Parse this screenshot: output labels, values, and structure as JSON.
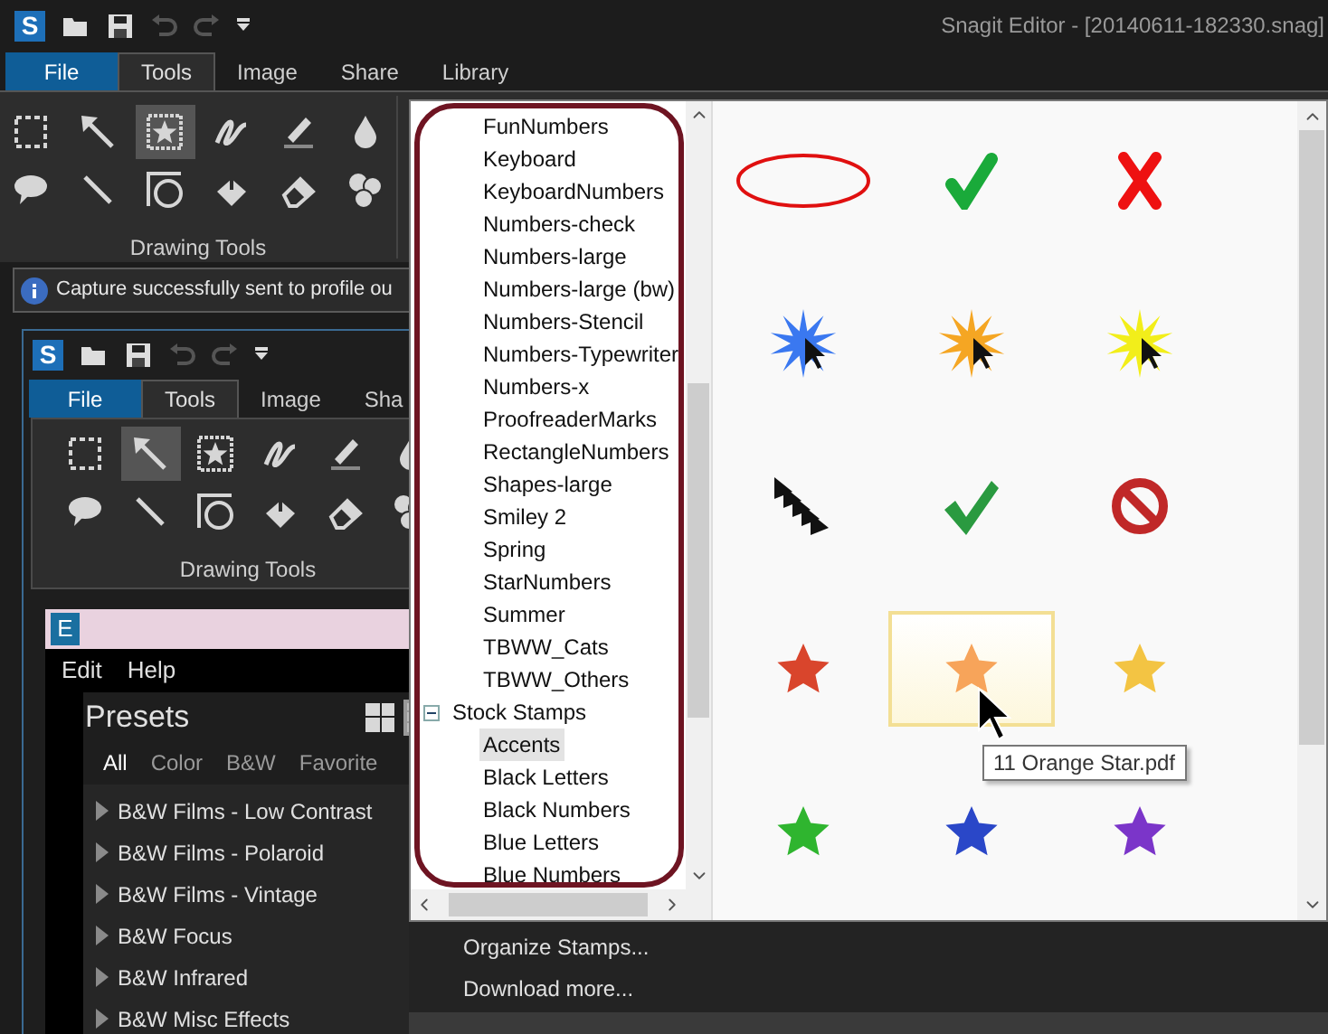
{
  "outer_window": {
    "logo": "S",
    "title": "Snagit Editor - [20140611-182330.snag]",
    "tabs": [
      {
        "label": "File",
        "kind": "file",
        "selected": false
      },
      {
        "label": "Tools",
        "kind": "tab",
        "selected": true
      },
      {
        "label": "Image",
        "kind": "tab",
        "selected": false
      },
      {
        "label": "Share",
        "kind": "tab",
        "selected": false
      },
      {
        "label": "Library",
        "kind": "tab",
        "selected": false
      }
    ],
    "tools": [
      {
        "kind": "selection",
        "selected": false
      },
      {
        "kind": "arrow",
        "selected": false
      },
      {
        "kind": "stamp",
        "selected": true
      },
      {
        "kind": "pen",
        "selected": false
      },
      {
        "kind": "highlighter",
        "selected": false
      },
      {
        "kind": "blur",
        "selected": false
      },
      {
        "kind": "callout",
        "selected": false
      },
      {
        "kind": "line",
        "selected": false
      },
      {
        "kind": "shape",
        "selected": false
      },
      {
        "kind": "fill",
        "selected": false
      },
      {
        "kind": "eraser",
        "selected": false
      },
      {
        "kind": "step",
        "selected": false
      }
    ],
    "tool_group": "Drawing Tools",
    "notification": "Capture successfully sent to profile ou"
  },
  "inner_window": {
    "logo": "S",
    "tabs": [
      {
        "label": "File",
        "kind": "file",
        "selected": false
      },
      {
        "label": "Tools",
        "kind": "tab",
        "selected": true
      },
      {
        "label": "Image",
        "kind": "tab",
        "selected": false
      },
      {
        "label": "Sha",
        "kind": "tab",
        "selected": false
      }
    ],
    "tools": [
      {
        "kind": "selection",
        "selected": false
      },
      {
        "kind": "arrow",
        "selected": true
      },
      {
        "kind": "stamp",
        "selected": false
      },
      {
        "kind": "pen",
        "selected": false
      },
      {
        "kind": "highlighter",
        "selected": false
      },
      {
        "kind": "blur",
        "selected": false
      },
      {
        "kind": "callout",
        "selected": false
      },
      {
        "kind": "line",
        "selected": false
      },
      {
        "kind": "shape",
        "selected": false
      },
      {
        "kind": "fill",
        "selected": false
      },
      {
        "kind": "eraser",
        "selected": false
      },
      {
        "kind": "step",
        "selected": false
      }
    ],
    "tool_group": "Drawing Tools"
  },
  "editor_window": {
    "logo": "E",
    "menu": [
      "Edit",
      "Help"
    ],
    "presets": {
      "title": "Presets",
      "view_modes": [
        {
          "kind": "large",
          "selected": false
        },
        {
          "kind": "small",
          "selected": true
        }
      ],
      "filters": [
        {
          "label": "All",
          "selected": true
        },
        {
          "label": "Color",
          "selected": false
        },
        {
          "label": "B&W",
          "selected": false
        },
        {
          "label": "Favorite",
          "selected": false
        }
      ],
      "items": [
        "B&W Films - Low Contrast",
        "B&W Films - Polaroid",
        "B&W Films - Vintage",
        "B&W Focus",
        "B&W Infrared",
        "B&W Misc Effects"
      ]
    }
  },
  "stamp_picker": {
    "tree": [
      {
        "children": [
          {
            "label": "FunNumbers",
            "selected": false
          },
          {
            "label": "Keyboard",
            "selected": false
          },
          {
            "label": "KeyboardNumbers",
            "selected": false
          },
          {
            "label": "Numbers-check",
            "selected": false
          },
          {
            "label": "Numbers-large",
            "selected": false
          },
          {
            "label": "Numbers-large (bw)",
            "selected": false
          },
          {
            "label": "Numbers-Stencil",
            "selected": false
          },
          {
            "label": "Numbers-Typewriter",
            "selected": false
          },
          {
            "label": "Numbers-x",
            "selected": false
          },
          {
            "label": "ProofreaderMarks",
            "selected": false
          },
          {
            "label": "RectangleNumbers",
            "selected": false
          },
          {
            "label": "Shapes-large",
            "selected": false
          },
          {
            "label": "Smiley 2",
            "selected": false
          },
          {
            "label": "Spring",
            "selected": false
          },
          {
            "label": "StarNumbers",
            "selected": false
          },
          {
            "label": "Summer",
            "selected": false
          },
          {
            "label": "TBWW_Cats",
            "selected": false
          },
          {
            "label": "TBWW_Others",
            "selected": false
          }
        ]
      },
      {
        "label": "Stock Stamps",
        "expanded": true,
        "selected": false,
        "children": [
          {
            "label": "Accents",
            "selected": true
          },
          {
            "label": "Black Letters",
            "selected": false
          },
          {
            "label": "Black Numbers",
            "selected": false
          },
          {
            "label": "Blue Letters",
            "selected": false
          },
          {
            "label": "Blue Numbers",
            "selected": false
          }
        ]
      }
    ],
    "stamps": [
      {
        "kind": "ellipse",
        "selected": false
      },
      {
        "kind": "check",
        "selected": false
      },
      {
        "kind": "cross",
        "selected": false
      },
      {
        "kind": "burst",
        "color": "#3a78f0",
        "selected": false
      },
      {
        "kind": "burst",
        "color": "#f5a623",
        "selected": false
      },
      {
        "kind": "burst",
        "color": "#f2ee1a",
        "selected": false
      },
      {
        "kind": "arrows",
        "selected": false
      },
      {
        "kind": "check3d",
        "selected": false
      },
      {
        "kind": "nosign",
        "selected": false
      },
      {
        "kind": "star",
        "color": "#d9452c",
        "selected": false
      },
      {
        "kind": "star",
        "color": "#f7a45a",
        "selected": true
      },
      {
        "kind": "star",
        "color": "#f3c443",
        "selected": false
      },
      {
        "kind": "star",
        "color": "#2fb52f",
        "selected": false
      },
      {
        "kind": "star",
        "color": "#2a47c8",
        "selected": false
      },
      {
        "kind": "star",
        "color": "#7b35c9",
        "selected": false
      }
    ],
    "tooltip": "11 Orange Star.pdf",
    "menu": [
      "Organize Stamps...",
      "Download more..."
    ]
  }
}
